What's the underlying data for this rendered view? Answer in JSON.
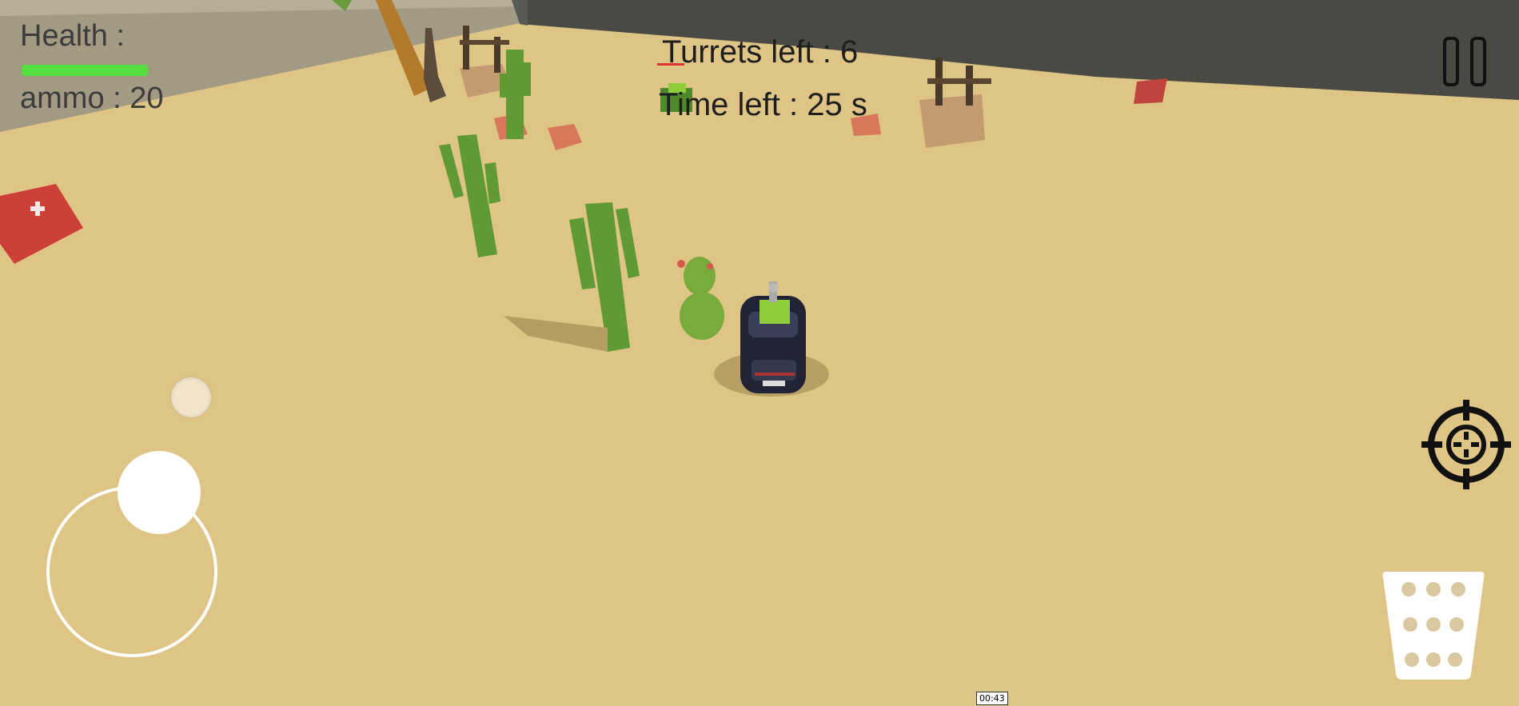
{
  "hud": {
    "health_label": "Health :",
    "health_fraction": 1.0,
    "ammo_label": "ammo : 20",
    "turrets_label": "Turrets left : 6",
    "time_label": "Time left : 25 s"
  },
  "controls": {
    "pause_icon": "pause-icon",
    "aim_icon": "crosshair-icon",
    "pedal_icon": "accelerator-pedal-icon",
    "joystick": "virtual-joystick"
  },
  "overlay": {
    "timestamp": "00:43"
  },
  "colors": {
    "sand": "#dfc585",
    "health_green": "#55e040",
    "cactus_green": "#5f9a35",
    "wall": "#4a4a45"
  }
}
